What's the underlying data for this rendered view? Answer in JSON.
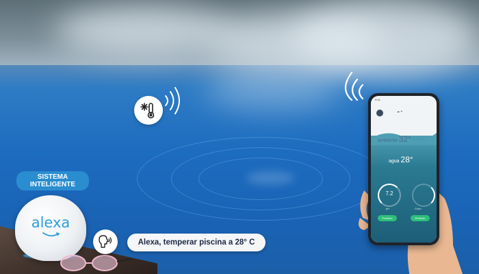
{
  "scene": {
    "subject": "",
    "colors": {
      "water": "#1c6cc0",
      "label_bg": "#2a8dd0",
      "success_green": "#2dbf7a"
    }
  },
  "system_label": "SISTEMA\nINTELIGENTE",
  "alexa_device": {
    "brand_text": "alexa"
  },
  "voice_command": {
    "text": "Alexa, temperar piscina a 28° C",
    "icon": "speaking-head-icon"
  },
  "sensor": {
    "icon": "thermometer-snowflake-icon"
  },
  "phone_app": {
    "ambient_label": "ambiente",
    "ambient_value": "32°",
    "water_label": "agua",
    "water_value": "28°",
    "ph_value": "7.2",
    "ph_label": "pH",
    "chlorine_label": "Cloro",
    "ph_status": "Perfecto",
    "chlorine_status": "Perfecto"
  }
}
